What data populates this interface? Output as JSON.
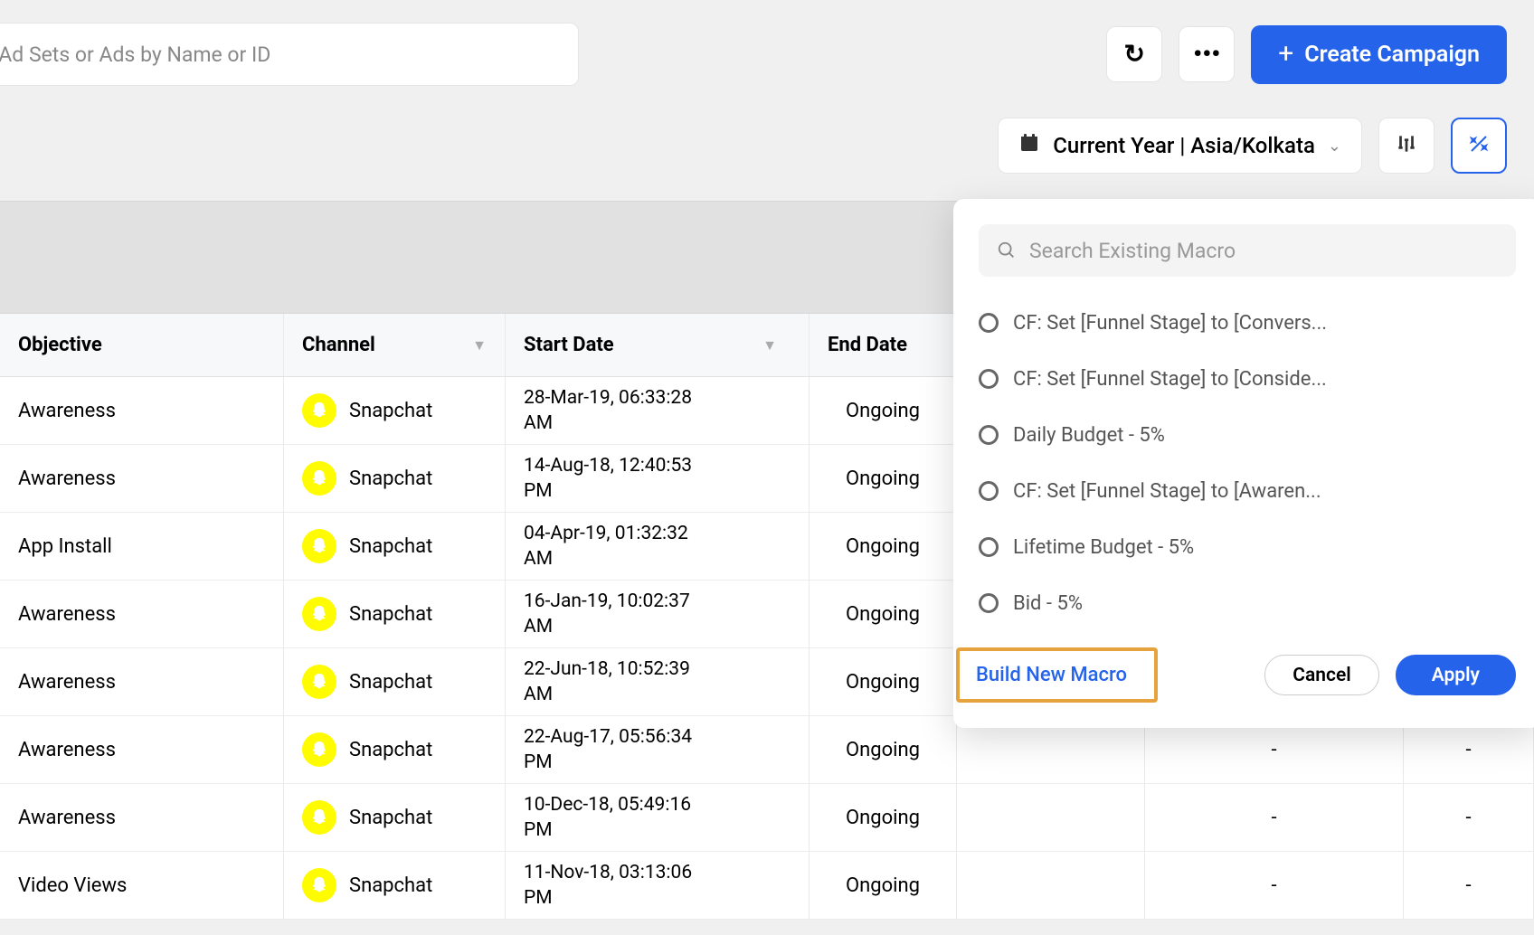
{
  "toolbar": {
    "search_placeholder": "d Initiatives, Ad Sets or Ads by Name or ID",
    "create_label": "Create Campaign"
  },
  "filters": {
    "date_label": "Current Year | Asia/Kolkata"
  },
  "table": {
    "headers": {
      "objective": "Objective",
      "channel": "Channel",
      "start": "Start Date",
      "end": "End Date"
    },
    "rows": [
      {
        "objective": "Awareness",
        "channel": "Snapchat",
        "start_l1": "28-Mar-19, 06:33:28",
        "start_l2": "AM",
        "end": "Ongoing",
        "c1": "",
        "c2": "",
        "c3": ""
      },
      {
        "objective": "Awareness",
        "channel": "Snapchat",
        "start_l1": "14-Aug-18, 12:40:53",
        "start_l2": "PM",
        "end": "Ongoing",
        "c1": "",
        "c2": "",
        "c3": ""
      },
      {
        "objective": "App Install",
        "channel": "Snapchat",
        "start_l1": "04-Apr-19, 01:32:32",
        "start_l2": "AM",
        "end": "Ongoing",
        "c1": "",
        "c2": "",
        "c3": ""
      },
      {
        "objective": "Awareness",
        "channel": "Snapchat",
        "start_l1": "16-Jan-19, 10:02:37",
        "start_l2": "AM",
        "end": "Ongoing",
        "c1": "",
        "c2": "",
        "c3": ""
      },
      {
        "objective": "Awareness",
        "channel": "Snapchat",
        "start_l1": "22-Jun-18, 10:52:39",
        "start_l2": "AM",
        "end": "Ongoing",
        "c1": "",
        "c2": "-",
        "c3": "-"
      },
      {
        "objective": "Awareness",
        "channel": "Snapchat",
        "start_l1": "22-Aug-17, 05:56:34",
        "start_l2": "PM",
        "end": "Ongoing",
        "c1": "",
        "c2": "-",
        "c3": "-"
      },
      {
        "objective": "Awareness",
        "channel": "Snapchat",
        "start_l1": "10-Dec-18, 05:49:16",
        "start_l2": "PM",
        "end": "Ongoing",
        "c1": "",
        "c2": "-",
        "c3": "-"
      },
      {
        "objective": "Video Views",
        "channel": "Snapchat",
        "start_l1": "11-Nov-18, 03:13:06",
        "start_l2": "PM",
        "end": "Ongoing",
        "c1": "",
        "c2": "-",
        "c3": "-"
      }
    ]
  },
  "macro_popover": {
    "search_placeholder": "Search Existing Macro",
    "items": [
      "CF: Set [Funnel Stage] to [Convers...",
      "CF: Set [Funnel Stage] to [Conside...",
      "Daily Budget - 5%",
      "CF: Set [Funnel Stage] to [Awaren...",
      "Lifetime Budget - 5%",
      "Bid - 5%"
    ],
    "build_link": "Build New Macro",
    "cancel": "Cancel",
    "apply": "Apply"
  }
}
